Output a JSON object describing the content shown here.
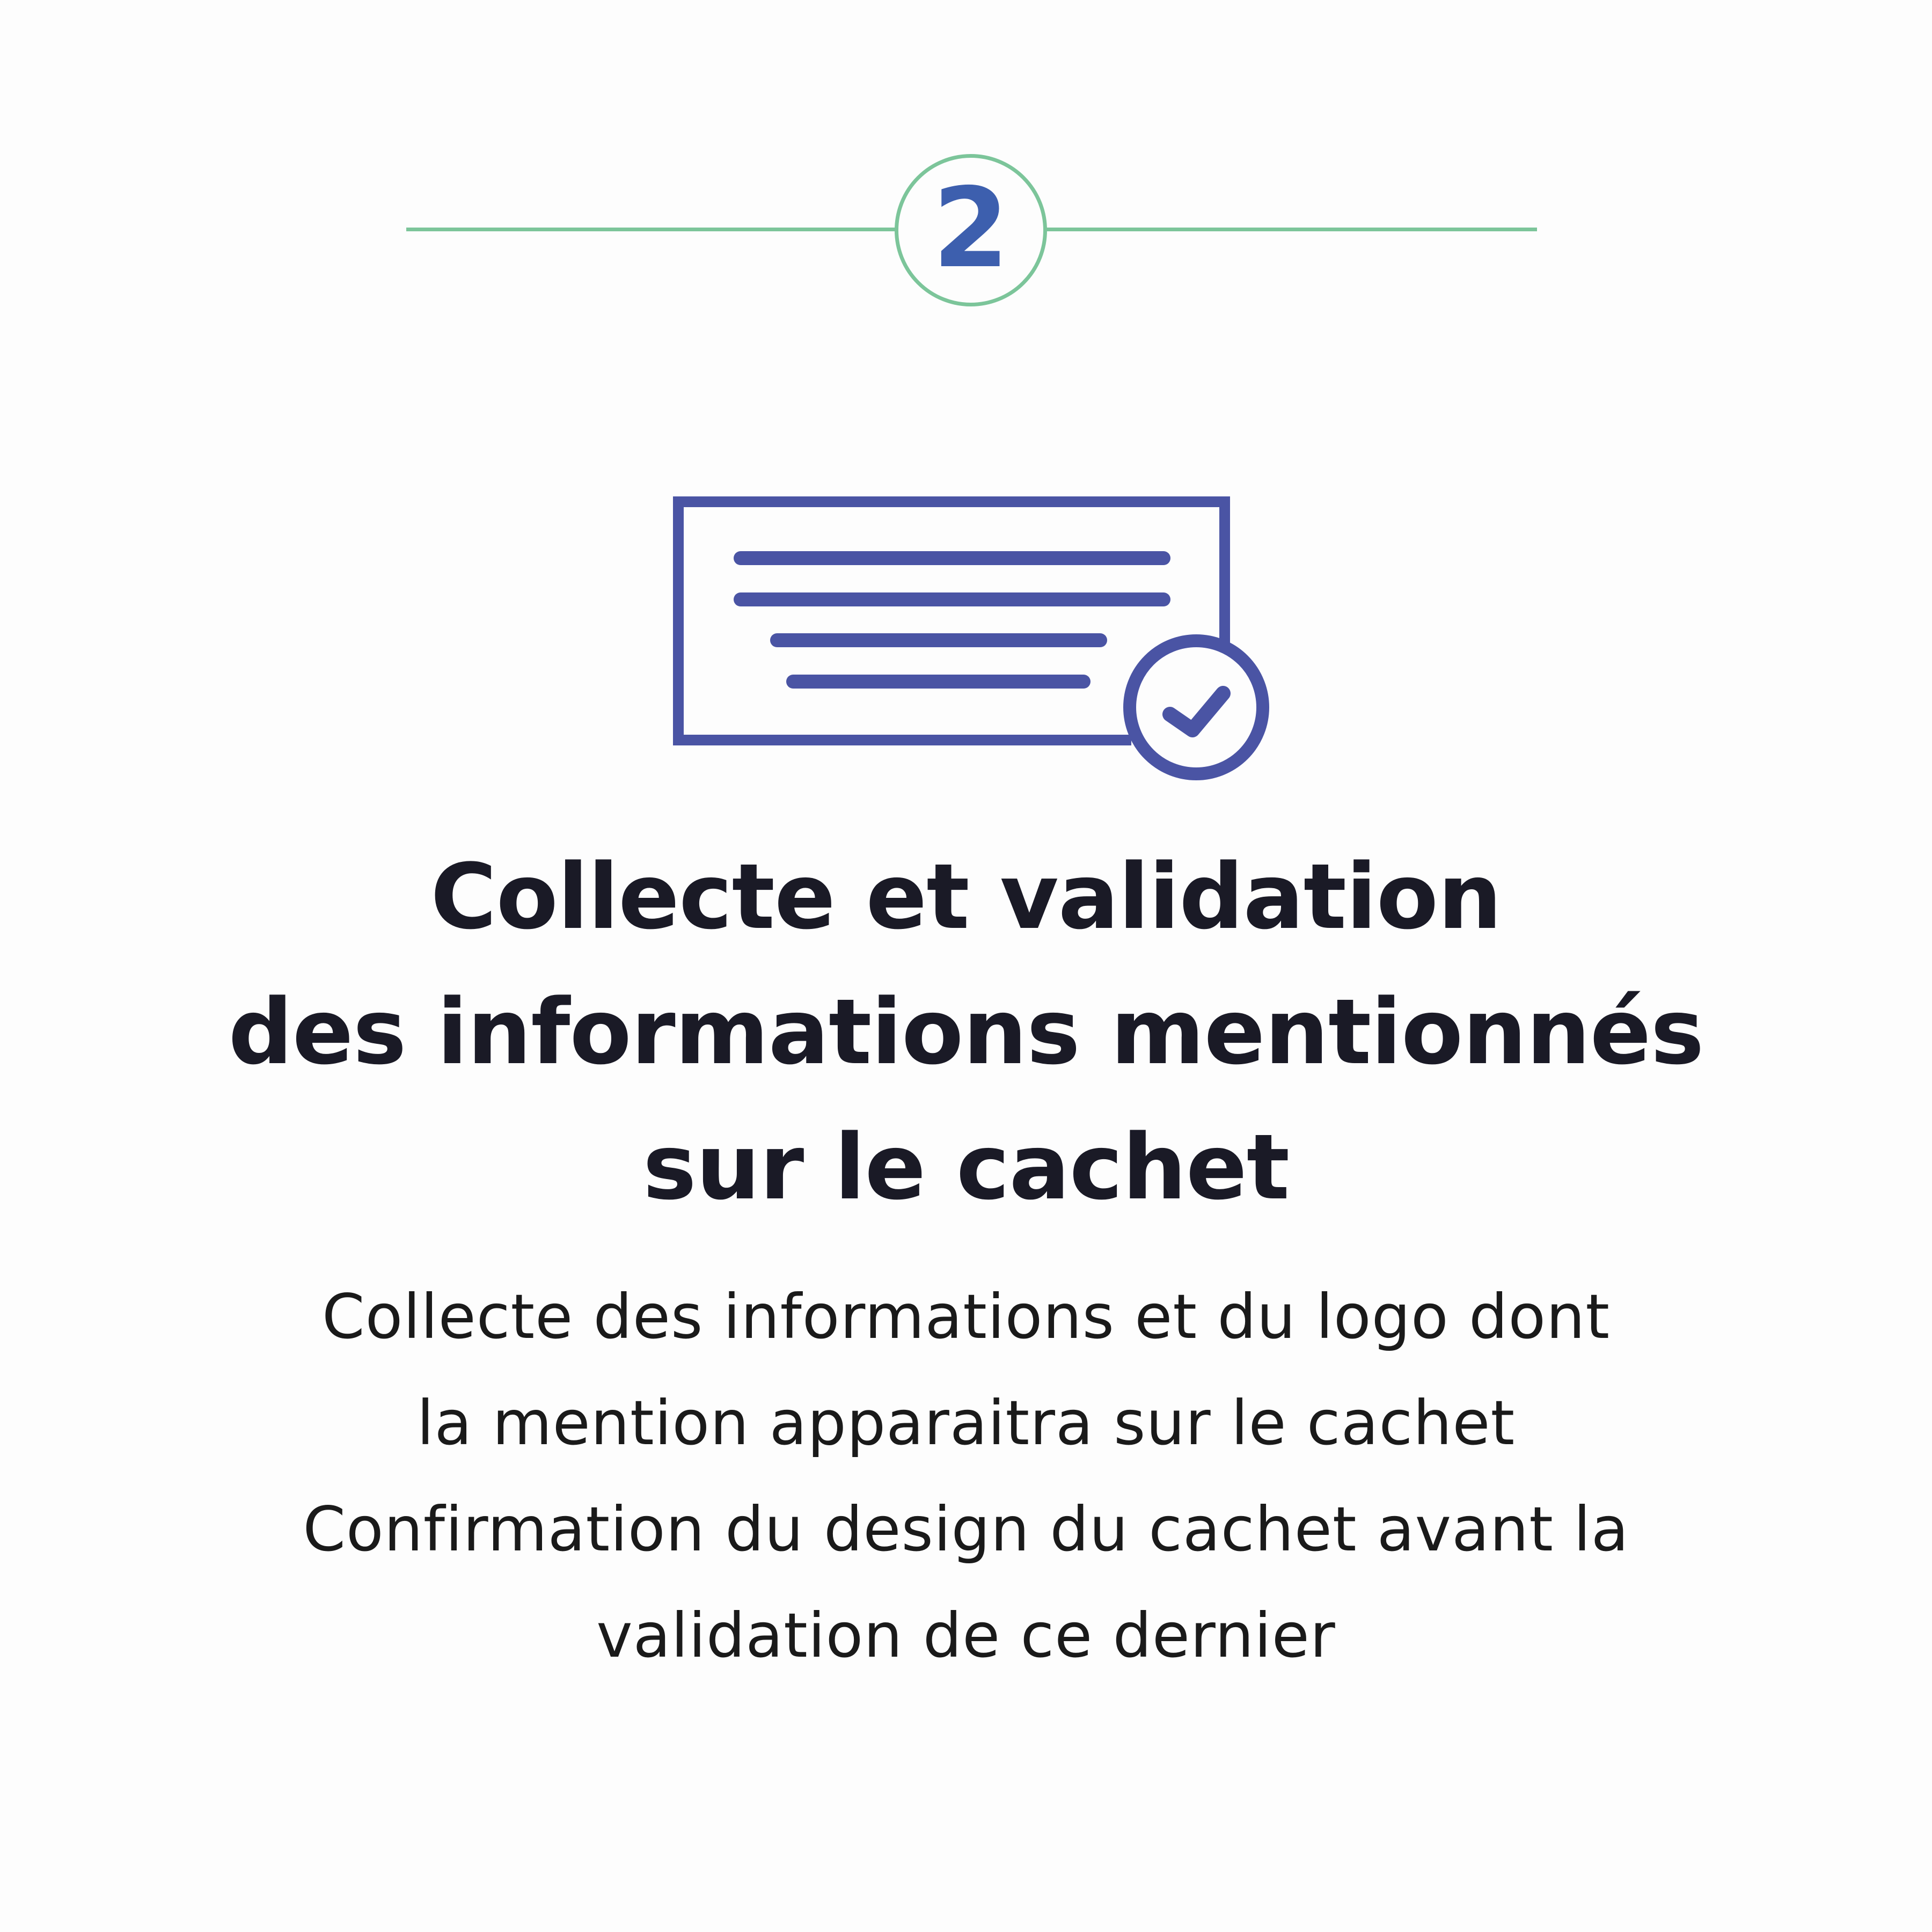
{
  "step": {
    "number": "2"
  },
  "icon": {
    "name": "document-check-icon",
    "color": "#4a54a4"
  },
  "title": {
    "lines": [
      "Collecte et validation",
      "des informations mentionnés",
      "sur le cachet"
    ]
  },
  "description": {
    "lines": [
      "Collecte des informations et du logo dont",
      "la mention apparaitra sur le cachet",
      "Confirmation du design du cachet avant la",
      "validation de ce dernier"
    ]
  },
  "colors": {
    "accent_green": "#7cc59a",
    "number_blue": "#3d5fae",
    "icon_indigo": "#4a54a4",
    "title_text": "#1a1a26",
    "background": "#fdfdfd"
  }
}
